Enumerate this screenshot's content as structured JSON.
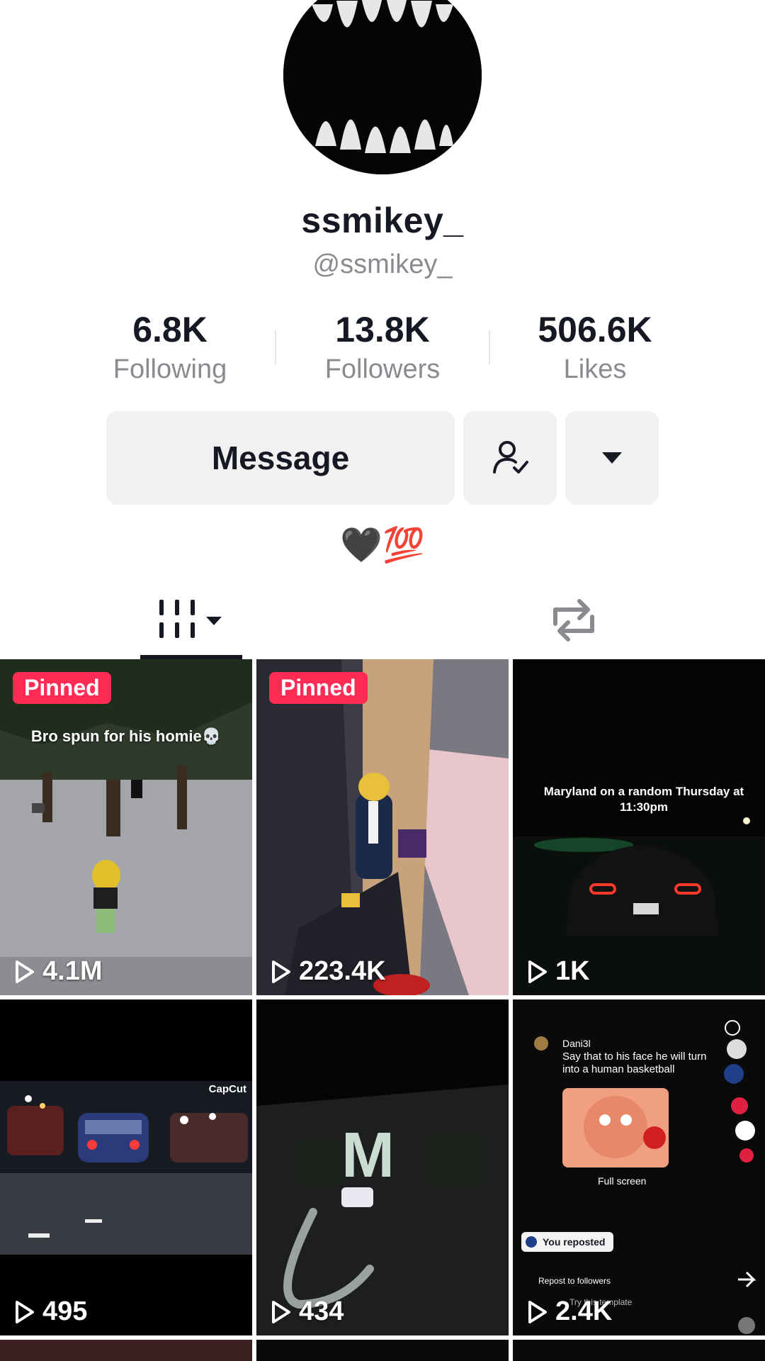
{
  "profile": {
    "display_name": "ssmikey_",
    "username": "@ssmikey_",
    "bio": "🖤💯"
  },
  "stats": [
    {
      "value": "6.8K",
      "label": "Following"
    },
    {
      "value": "13.8K",
      "label": "Followers"
    },
    {
      "value": "506.6K",
      "label": "Likes"
    }
  ],
  "actions": {
    "message_label": "Message",
    "follow_icon": "person-check-icon",
    "more_icon": "caret-down-icon"
  },
  "tabs": [
    {
      "icon": "videos-grid-icon",
      "selected": true
    },
    {
      "icon": "repost-icon",
      "selected": false
    }
  ],
  "videos": [
    {
      "pinned": "Pinned",
      "caption": "Bro spun for his homie💀",
      "views": "4.1M"
    },
    {
      "pinned": "Pinned",
      "caption": "",
      "views": "223.4K"
    },
    {
      "pinned": "",
      "caption": "Maryland on a random Thursday at 11:30pm",
      "views": "1K"
    },
    {
      "pinned": "",
      "caption": "",
      "watermark": "CapCut",
      "views": "495"
    },
    {
      "pinned": "",
      "caption": "",
      "views": "434"
    },
    {
      "pinned": "",
      "comment_user": "Dani3l",
      "comment_text": "Say that to his face he will turn into a human basketball",
      "full_screen": "Full screen",
      "you_reposted": "You reposted",
      "repost_to_followers": "Repost to followers",
      "template_text": "Try this template",
      "views": "2.4K"
    }
  ],
  "colors": {
    "accent": "#fe2c55",
    "text": "#161823",
    "muted": "#8a8b91",
    "button_bg": "#f1f1f2"
  }
}
